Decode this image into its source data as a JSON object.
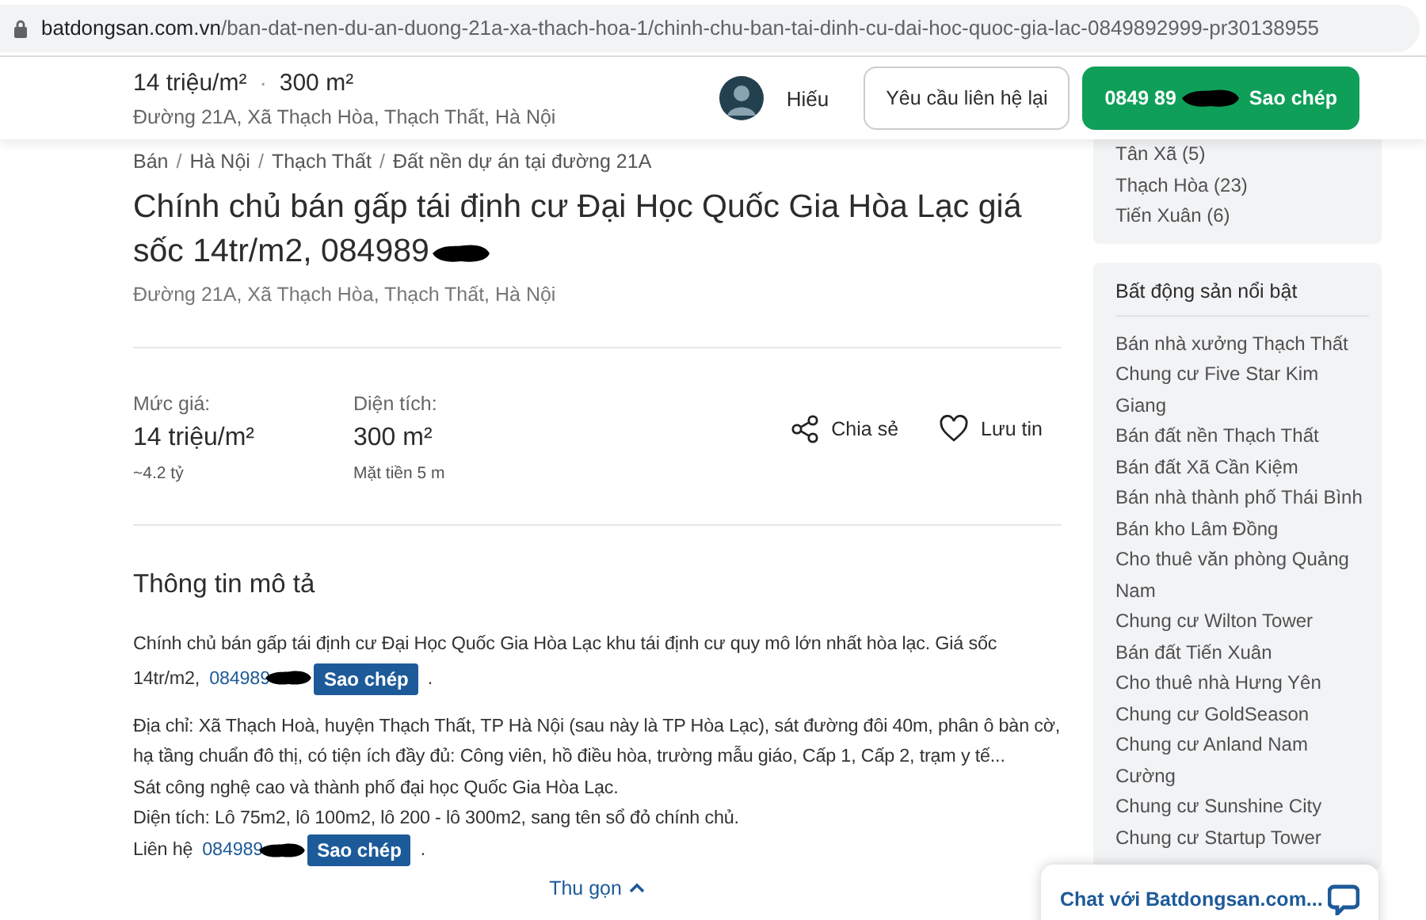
{
  "address_bar": {
    "domain": "batdongsan.com.vn",
    "path": "/ban-dat-nen-du-an-duong-21a-xa-thach-hoa-1/chinh-chu-ban-tai-dinh-cu-dai-hoc-quoc-gia-lac-0849892999-pr30138955"
  },
  "header": {
    "price": "14 triệu/m²",
    "separator": "·",
    "area": "300 m²",
    "address": "Đường 21A, Xã Thạch Hòa, Thạch Thất, Hà Nội",
    "agent_name": "Hiếu",
    "contact_button": "Yêu cầu liên hệ lại",
    "phone_button": {
      "number": "0849 89",
      "action": "Sao chép"
    }
  },
  "breadcrumbs": {
    "separator": "/",
    "items": [
      "Bán",
      "Hà Nội",
      "Thạch Thất",
      "Đất nền dự án tại đường 21A"
    ]
  },
  "title": "Chính chủ bán gấp tái định cư Đại Học Quốc Gia Hòa Lạc giá sốc 14tr/m2, 084989",
  "address": "Đường 21A, Xã Thạch Hòa, Thạch Thất, Hà Nội",
  "stats": [
    {
      "label": "Mức giá:",
      "value": "14 triệu/m²",
      "note": "~4.2 tỷ"
    },
    {
      "label": "Diện tích:",
      "value": "300 m²",
      "note": "Mặt tiền 5 m"
    }
  ],
  "actions": [
    {
      "kind": "share",
      "label": "Chia sẻ"
    },
    {
      "kind": "save",
      "label": "Lưu tin"
    }
  ],
  "description": {
    "heading": "Thông tin mô tả",
    "lines": [
      {
        "kind": "text",
        "text": "Chính chủ bán gấp tái định cư Đại Học Quốc Gia Hòa Lạc khu tái định cư quy mô lớn nhất hòa lạc. Giá sốc"
      },
      {
        "kind": "contact",
        "text": "14tr/m2,",
        "phone": "084989",
        "button": "Sao chép",
        "end": "."
      },
      {
        "kind": "text",
        "text": "Địa chỉ: Xã Thạch Hoà, huyện Thạch Thất, TP Hà Nội (sau này là TP Hòa Lạc), sát đường đôi 40m, phân ô bàn cờ, hạ tầng chuẩn đô thị, có tiện ích đầy đủ: Công viên, hồ điều hòa, trường mẫu giáo, Cấp 1, Cấp 2, trạm y tế..."
      },
      {
        "kind": "text",
        "text": "Sát công nghệ cao và thành phố đại học Quốc Gia Hòa Lạc."
      },
      {
        "kind": "text",
        "text": "Diện tích: Lô 75m2, lô 100m2, lô 200 - lô 300m2, sang tên sổ đỏ chính chủ."
      },
      {
        "kind": "contact",
        "text": "Liên hệ",
        "phone": "084989",
        "button": "Sao chép",
        "end": "."
      }
    ],
    "collapse": "Thu gọn"
  },
  "sidebar": {
    "areas": [
      "Tân Xã (5)",
      "Thạch Hòa (23)",
      "Tiến Xuân (6)"
    ],
    "featured": {
      "title": "Bất động sản nổi bật",
      "items": [
        "Bán nhà xưởng Thạch Thất",
        "Chung cư Five Star Kim Giang",
        "Bán đất nền Thạch Thất",
        "Bán đất Xã Cần Kiệm",
        "Bán nhà thành phố Thái Bình",
        "Bán kho Lâm Đồng",
        "Cho thuê văn phòng Quảng Nam",
        "Chung cư Wilton Tower",
        "Bán đất Tiến Xuân",
        "Cho thuê nhà Hưng Yên",
        "Chung cư GoldSeason",
        "Chung cư Anland Nam Cường",
        "Chung cư Sunshine City",
        "Chung cư Startup Tower"
      ]
    }
  },
  "chat": {
    "label": "Chat với Batdongsan.com..."
  }
}
